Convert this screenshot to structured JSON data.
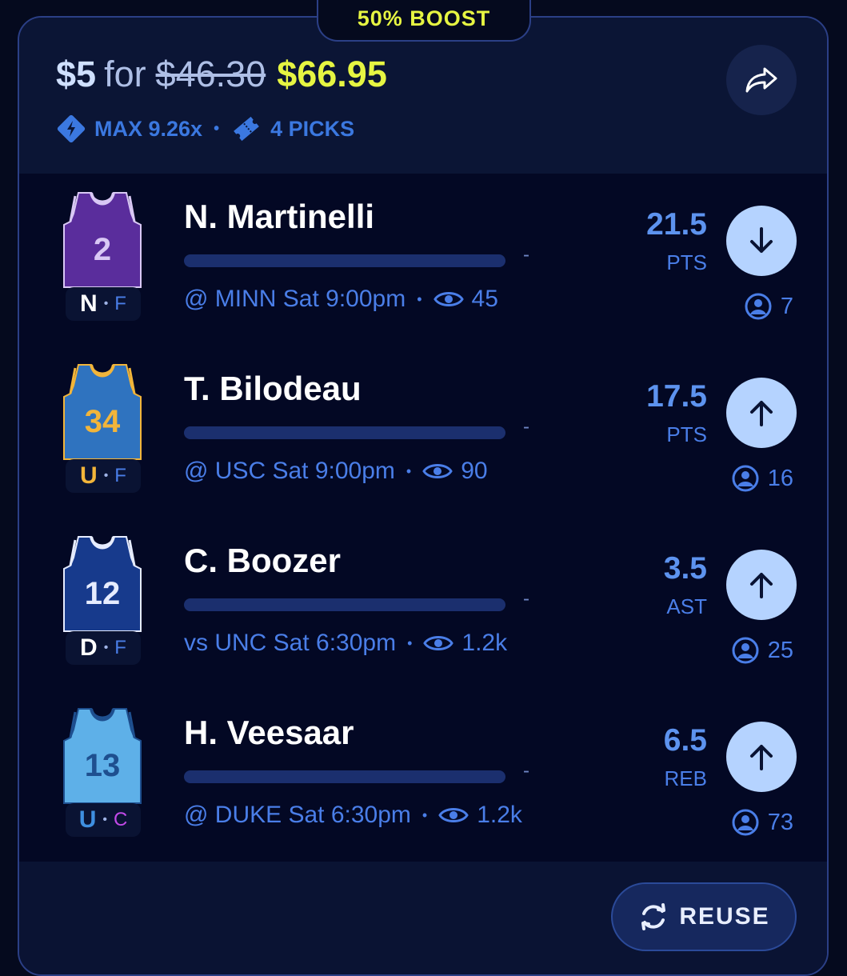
{
  "boost_label": "50% BOOST",
  "header": {
    "stake": "$5",
    "for_word": "for",
    "old_payout": "$46.30",
    "new_payout": "$66.95",
    "max_multiplier": "MAX 9.26x",
    "picks_count": "4 PICKS",
    "share_icon": "share-arrow-icon"
  },
  "colors": {
    "accent_yellow": "#e6f542",
    "accent_blue": "#3b78e0",
    "button_light": "#b5d3ff",
    "background": "#030824"
  },
  "picks": [
    {
      "name": "N. Martinelli",
      "team_letter": "N",
      "position": "F",
      "jersey_number": "2",
      "jersey_color": "#5a2d9c",
      "jersey_trim": "#d9c8f5",
      "team_letter_color": "#ffffff",
      "position_color": "#4a7ee8",
      "progress_fraction": 0,
      "progress_dash": "-",
      "game": "@ MINN Sat 9:00pm",
      "viewers": "45",
      "line": "21.5",
      "stat": "PTS",
      "direction": "down",
      "direction_icon": "arrow-down-icon",
      "users": "7"
    },
    {
      "name": "T. Bilodeau",
      "team_letter": "U",
      "position": "F",
      "jersey_number": "34",
      "jersey_color": "#2f73bf",
      "jersey_trim": "#f2b53a",
      "team_letter_color": "#f2b53a",
      "position_color": "#4a7ee8",
      "progress_fraction": 0,
      "progress_dash": "-",
      "game": "@ USC Sat 9:00pm",
      "viewers": "90",
      "line": "17.5",
      "stat": "PTS",
      "direction": "up",
      "direction_icon": "arrow-up-icon",
      "users": "16"
    },
    {
      "name": "C. Boozer",
      "team_letter": "D",
      "position": "F",
      "jersey_number": "12",
      "jersey_color": "#173a8c",
      "jersey_trim": "#e6ecff",
      "team_letter_color": "#ffffff",
      "position_color": "#4a7ee8",
      "progress_fraction": 0,
      "progress_dash": "-",
      "game": "vs UNC Sat 6:30pm",
      "viewers": "1.2k",
      "line": "3.5",
      "stat": "AST",
      "direction": "up",
      "direction_icon": "arrow-up-icon",
      "users": "25"
    },
    {
      "name": "H. Veesaar",
      "team_letter": "U",
      "position": "C",
      "jersey_number": "13",
      "jersey_color": "#5eb0e8",
      "jersey_trim": "#1e4f8f",
      "team_letter_color": "#3f8fe0",
      "position_color": "#c24ae8",
      "progress_fraction": 0,
      "progress_dash": "-",
      "game": "@ DUKE Sat 6:30pm",
      "viewers": "1.2k",
      "line": "6.5",
      "stat": "REB",
      "direction": "up",
      "direction_icon": "arrow-up-icon",
      "users": "73"
    }
  ],
  "footer": {
    "reuse_label": "REUSE",
    "reuse_icon": "refresh-icon"
  }
}
